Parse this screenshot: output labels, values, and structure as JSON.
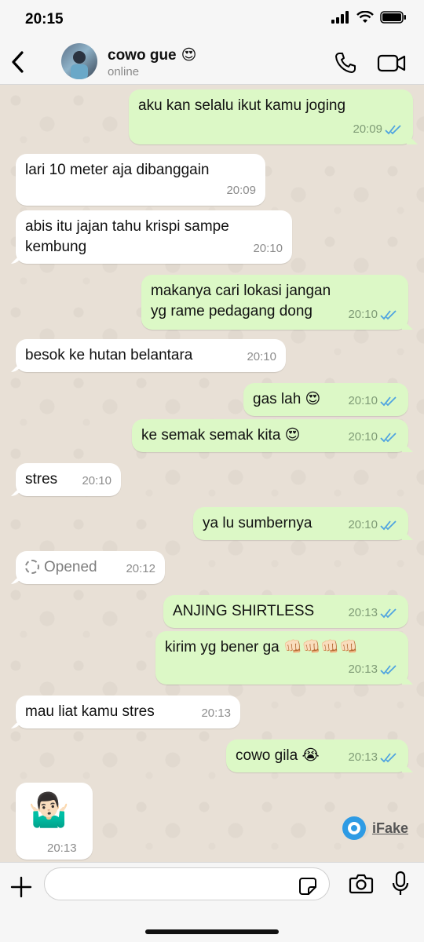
{
  "status_bar": {
    "time": "20:15",
    "icons": [
      "signal-icon",
      "wifi-icon",
      "battery-icon"
    ]
  },
  "header": {
    "contact_name": "cowo gue",
    "contact_emoji": "😍",
    "contact_status": "online"
  },
  "messages": [
    {
      "dir": "out",
      "text": "aku kan selalu ikut kamu joging",
      "time": "20:09",
      "read": true
    },
    {
      "dir": "in",
      "text": "lari 10 meter aja dibanggain",
      "time": "20:09"
    },
    {
      "dir": "in",
      "text": "abis itu jajan tahu krispi sampe kembung",
      "time": "20:10"
    },
    {
      "dir": "out",
      "text": "makanya cari lokasi jangan yg rame pedagang dong",
      "time": "20:10",
      "read": true
    },
    {
      "dir": "in",
      "text": "besok ke hutan belantara",
      "time": "20:10"
    },
    {
      "dir": "out",
      "text": "gas lah 😍",
      "time": "20:10",
      "read": true
    },
    {
      "dir": "out",
      "text": "ke semak semak kita 😍",
      "time": "20:10",
      "read": true
    },
    {
      "dir": "in",
      "text": "stres",
      "time": "20:10"
    },
    {
      "dir": "out",
      "text": "ya lu sumbernya",
      "time": "20:10",
      "read": true
    },
    {
      "dir": "in",
      "text": "Opened",
      "time": "20:12",
      "opened": true
    },
    {
      "dir": "out",
      "text": "ANJING SHIRTLESS",
      "time": "20:13",
      "read": true
    },
    {
      "dir": "out",
      "text": "kirim yg bener ga 👊🏻👊🏻👊🏻👊🏻",
      "time": "20:13",
      "read": true
    },
    {
      "dir": "in",
      "text": "mau liat kamu stres",
      "time": "20:13"
    },
    {
      "dir": "out",
      "text": "cowo gila 😭",
      "time": "20:13",
      "read": true
    },
    {
      "dir": "in",
      "text": "🤷🏻‍♂️",
      "time": "20:13",
      "sticker": true
    }
  ],
  "watermark": {
    "text": "iFake"
  },
  "input": {
    "placeholder": ""
  },
  "colors": {
    "incoming": "#ffffff",
    "outgoing": "#dcf8c6",
    "tick_read": "#4fa3e0"
  }
}
